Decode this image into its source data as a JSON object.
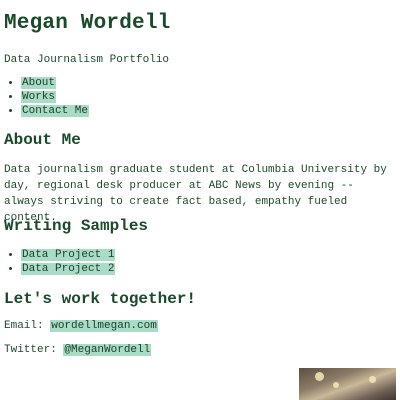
{
  "header": {
    "title": "Megan Wordell",
    "subtitle": "Data Journalism Portfolio"
  },
  "nav": {
    "items": [
      {
        "label": "About"
      },
      {
        "label": "Works"
      },
      {
        "label": "Contact Me"
      }
    ]
  },
  "about": {
    "heading": "About Me",
    "text": "Data journalism graduate student at Columbia University by day, regional desk producer at ABC News by evening -- always striving to create fact based, empathy fueled content."
  },
  "samples": {
    "heading": "Writing Samples",
    "items": [
      {
        "label": "Data Project 1"
      },
      {
        "label": "Data Project 2"
      }
    ]
  },
  "contact": {
    "heading": "Let's work together!",
    "email_label": "Email:",
    "email_value": "wordellmegan.com",
    "twitter_label": "Twitter:",
    "twitter_value": "@MeganWordell"
  },
  "colors": {
    "text": "#1b4a2b",
    "highlight": "#a9dcc6",
    "background": "#ffffff"
  }
}
